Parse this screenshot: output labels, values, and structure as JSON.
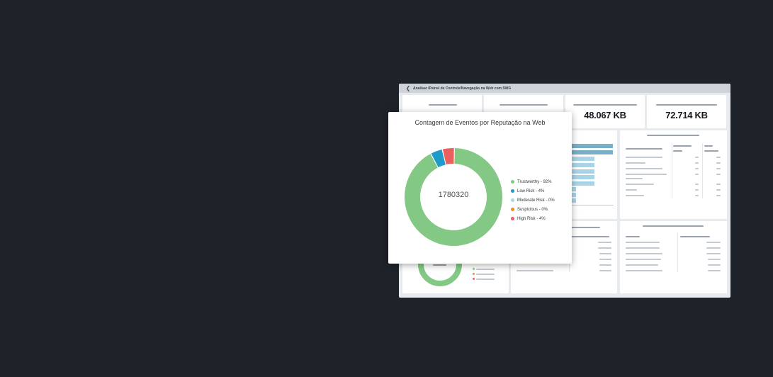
{
  "breadcrumb": "Analisar /Painel de Controle/Navegação na Web com SWG",
  "kpis": [
    {
      "value": ""
    },
    {
      "value": ""
    },
    {
      "value": "48.067 KB"
    },
    {
      "value": "72.714 KB"
    }
  ],
  "popup": {
    "title": "Contagem de Eventos por Reputação na Web",
    "center_value": "1780320"
  },
  "colors": {
    "trustworthy": "#83c885",
    "low_risk": "#1e9bc6",
    "moderate_risk": "#a9d4e8",
    "suspicious": "#f08c1e",
    "high_risk": "#ec5f5f"
  },
  "chart_data": {
    "type": "pie",
    "title": "Contagem de Eventos por Reputação na Web",
    "center_label": "1780320",
    "legend_position": "right",
    "categories": [
      "Trustworthy",
      "Low Risk",
      "Moderate Risk",
      "Suspicious",
      "High Risk"
    ],
    "values": [
      92,
      4,
      0,
      0,
      4
    ],
    "labels": [
      "Trustworthy - 92%",
      "Low Risk - 4%",
      "Moderate Risk - 0%",
      "Suspicious - 0%",
      "High Risk - 4%"
    ]
  }
}
